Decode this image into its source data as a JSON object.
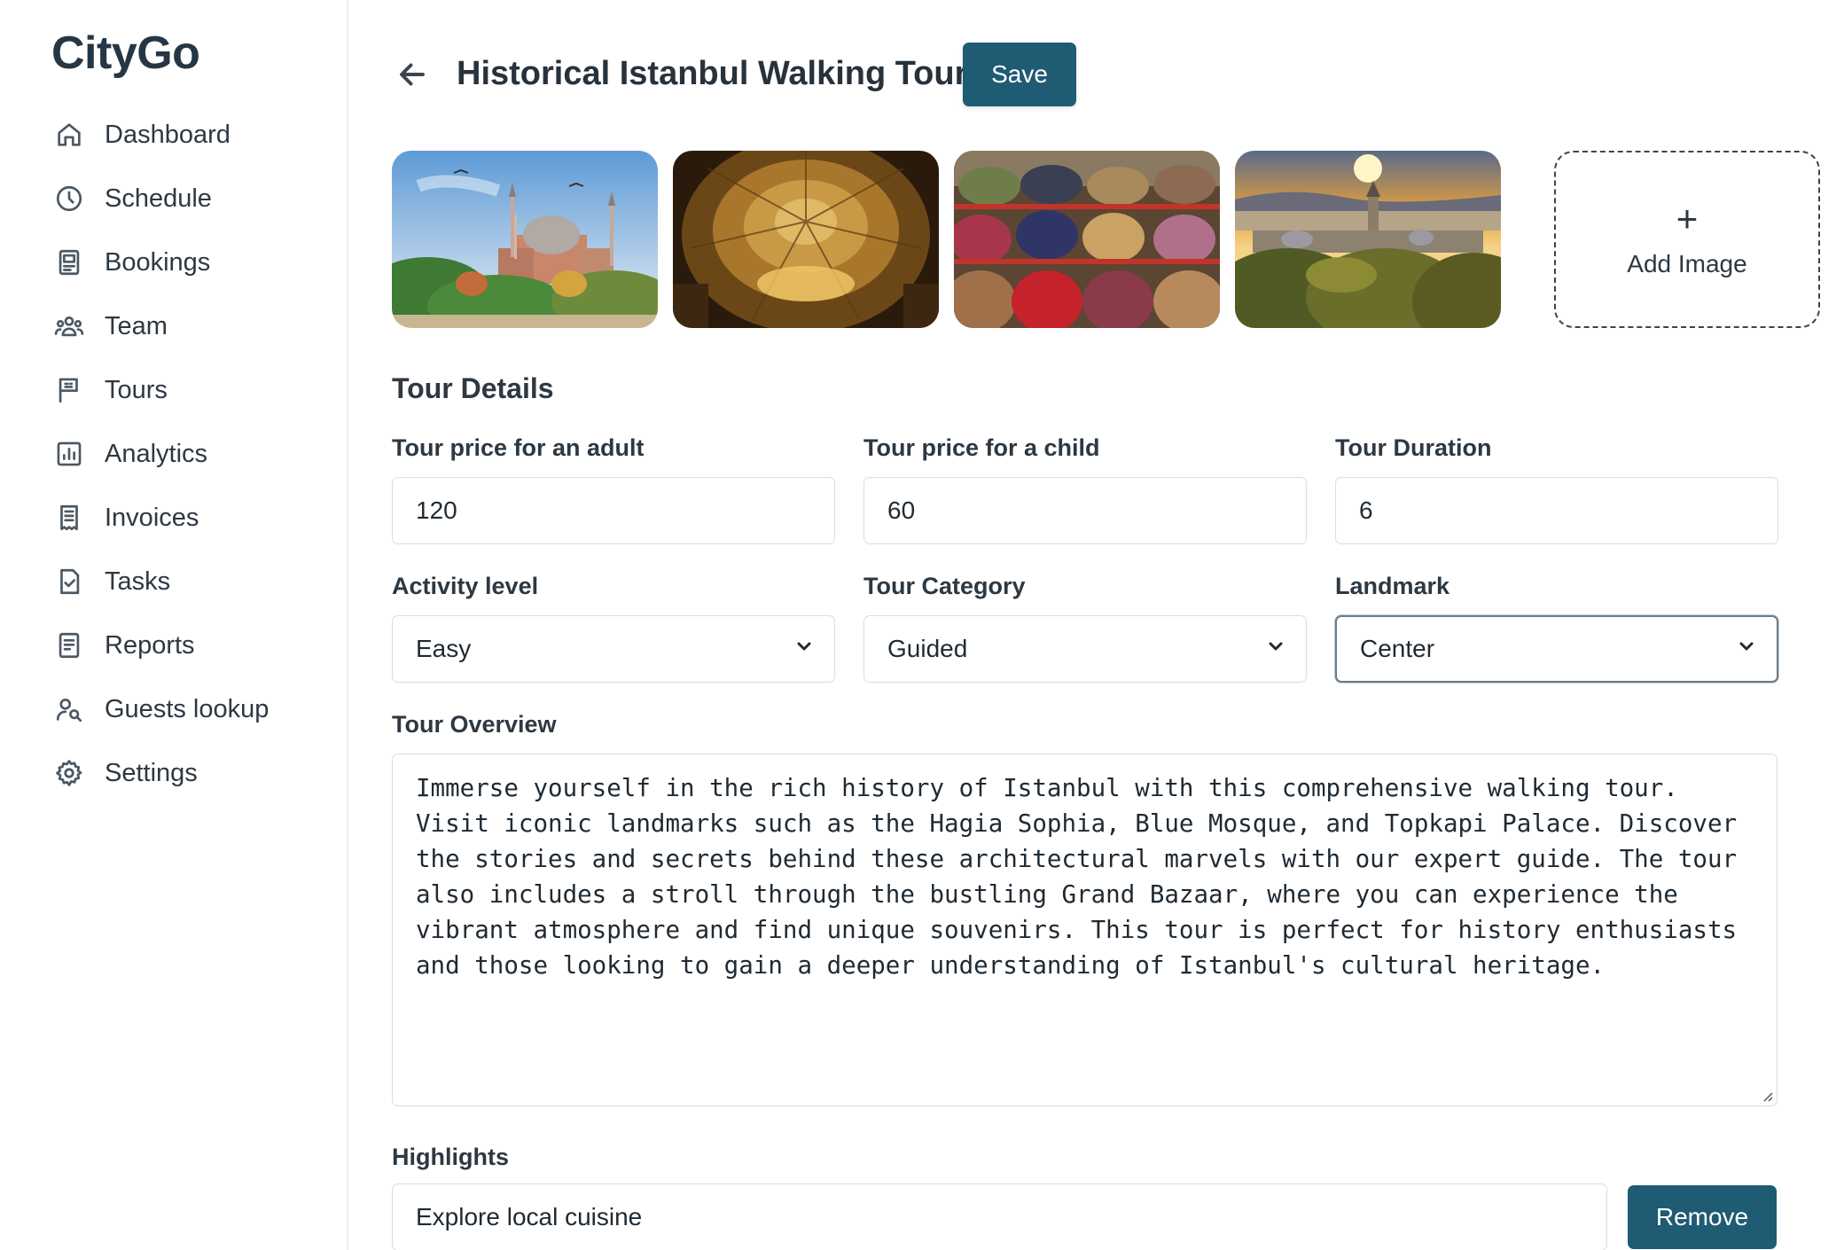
{
  "app": {
    "name": "CityGo"
  },
  "sidebar": {
    "items": [
      {
        "label": "Dashboard",
        "icon": "home-icon"
      },
      {
        "label": "Schedule",
        "icon": "clock-icon"
      },
      {
        "label": "Bookings",
        "icon": "booking-icon"
      },
      {
        "label": "Team",
        "icon": "team-icon"
      },
      {
        "label": "Tours",
        "icon": "flag-icon"
      },
      {
        "label": "Analytics",
        "icon": "chart-icon"
      },
      {
        "label": "Invoices",
        "icon": "invoice-icon"
      },
      {
        "label": "Tasks",
        "icon": "task-icon"
      },
      {
        "label": "Reports",
        "icon": "report-icon"
      },
      {
        "label": "Guests lookup",
        "icon": "guest-search-icon"
      },
      {
        "label": "Settings",
        "icon": "gear-icon"
      }
    ]
  },
  "header": {
    "title": "Historical Istanbul Walking Tour",
    "save_label": "Save"
  },
  "gallery": {
    "images": [
      "Hagia Sophia exterior",
      "Hagia Sophia dome interior",
      "Spice bazaar",
      "Galata tower sunset"
    ],
    "add_plus": "+",
    "add_label": "Add Image"
  },
  "details": {
    "section_title": "Tour Details",
    "adult_price": {
      "label": "Tour price for an adult",
      "value": "120"
    },
    "child_price": {
      "label": "Tour price for a child",
      "value": "60"
    },
    "duration": {
      "label": "Tour Duration",
      "value": "6"
    },
    "activity": {
      "label": "Activity level",
      "value": "Easy"
    },
    "category": {
      "label": "Tour Category",
      "value": "Guided"
    },
    "landmark": {
      "label": "Landmark",
      "value": "Center"
    }
  },
  "overview": {
    "label": "Tour Overview",
    "text": "Immerse yourself in the rich history of Istanbul with this comprehensive walking tour. Visit iconic landmarks such as the Hagia Sophia, Blue Mosque, and Topkapi Palace. Discover the stories and secrets behind these architectural marvels with our expert guide. The tour also includes a stroll through the bustling Grand Bazaar, where you can experience the vibrant atmosphere and find unique souvenirs. This tour is perfect for history enthusiasts and those looking to gain a deeper understanding of Istanbul's cultural heritage."
  },
  "highlights": {
    "label": "Highlights",
    "items": [
      {
        "value": "Explore local cuisine",
        "remove_label": "Remove"
      }
    ]
  },
  "colors": {
    "primary": "#1f5b73",
    "text": "#2d3842",
    "border": "#d9dde1"
  }
}
